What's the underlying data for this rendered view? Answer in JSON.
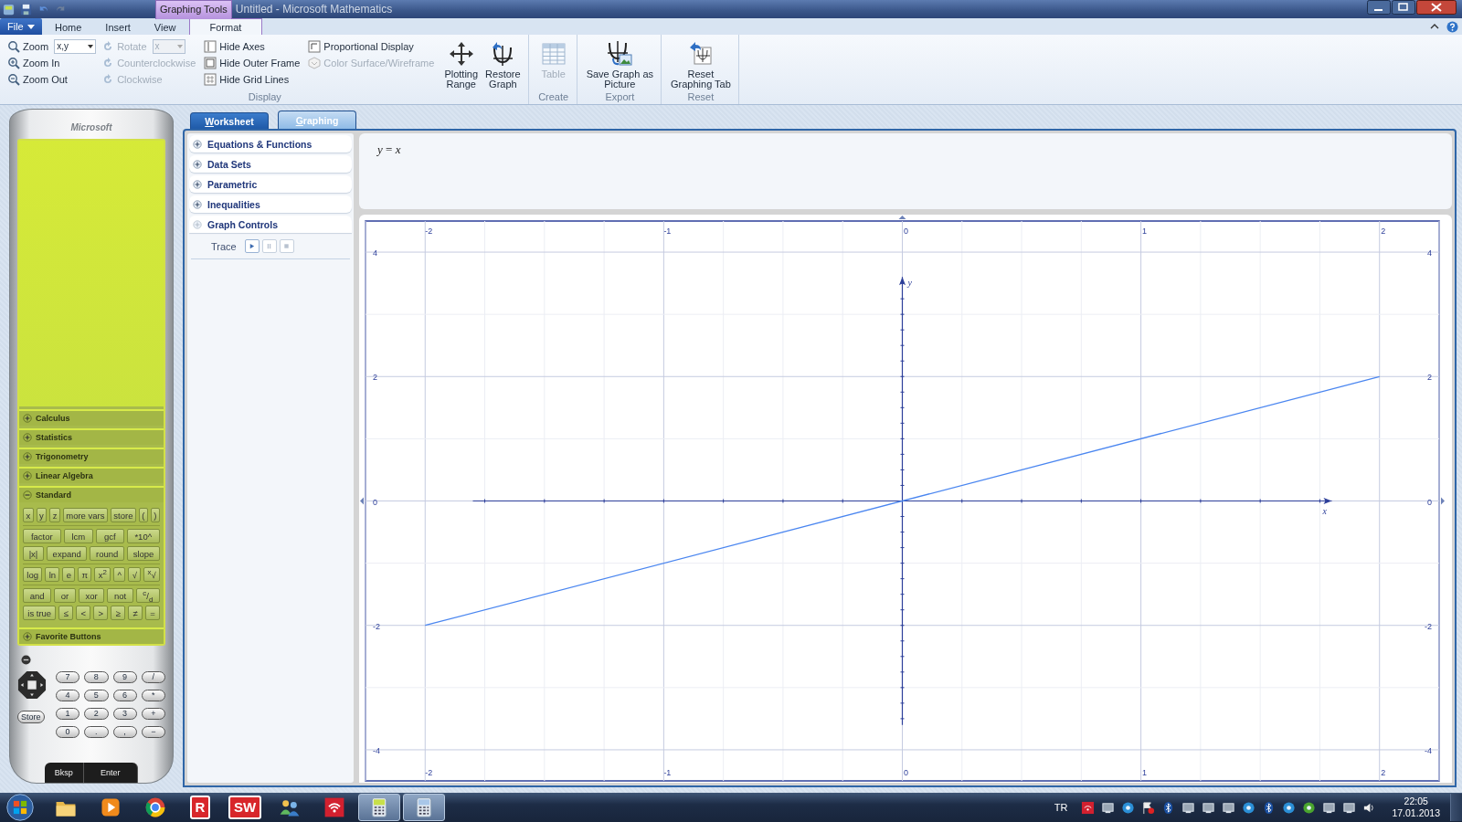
{
  "window": {
    "context_label": "Graphing Tools",
    "title": "Untitled - Microsoft Mathematics"
  },
  "ribbon": {
    "tabs": [
      {
        "label": "File",
        "kind": "menu",
        "selected": false
      },
      {
        "label": "Home",
        "kind": "tab",
        "selected": false
      },
      {
        "label": "Insert",
        "kind": "tab",
        "selected": false
      },
      {
        "label": "View",
        "kind": "tab",
        "selected": false
      },
      {
        "label": "Format",
        "kind": "tab",
        "selected": true
      }
    ],
    "groups": [
      {
        "label": "Display",
        "columns": [
          [
            {
              "kind": "combo",
              "label": "Zoom",
              "value": "x,y",
              "disabled": false
            },
            {
              "kind": "button",
              "label": "Zoom In",
              "disabled": false
            },
            {
              "kind": "button",
              "label": "Zoom Out",
              "disabled": false
            }
          ],
          [
            {
              "kind": "combo",
              "label": "Rotate",
              "value": "x",
              "disabled": true
            },
            {
              "kind": "button",
              "label": "Counterclockwise",
              "disabled": true
            },
            {
              "kind": "button",
              "label": "Clockwise",
              "disabled": true
            }
          ],
          [
            {
              "kind": "button",
              "label": "Hide Axes",
              "disabled": false
            },
            {
              "kind": "button",
              "label": "Hide Outer Frame",
              "disabled": false
            },
            {
              "kind": "button",
              "label": "Hide Grid Lines",
              "disabled": false
            }
          ],
          [
            {
              "kind": "button",
              "label": "Proportional Display",
              "disabled": false
            },
            {
              "kind": "button",
              "label": "Color Surface/Wireframe",
              "disabled": true
            }
          ]
        ],
        "buttons": [
          {
            "lines": [
              "Plotting",
              "Range"
            ],
            "disabled": false
          },
          {
            "lines": [
              "Restore",
              "Graph"
            ],
            "disabled": false
          }
        ]
      },
      {
        "label": "Create",
        "buttons": [
          {
            "lines": [
              "Table"
            ],
            "disabled": true
          }
        ]
      },
      {
        "label": "Export",
        "buttons": [
          {
            "lines": [
              "Save Graph as",
              "Picture"
            ],
            "disabled": false
          }
        ]
      },
      {
        "label": "Reset",
        "buttons": [
          {
            "lines": [
              "Reset",
              "Graphing Tab"
            ],
            "disabled": false
          }
        ]
      }
    ]
  },
  "calculator": {
    "brand": "Microsoft",
    "sections": [
      {
        "label": "Calculus",
        "expanded": false
      },
      {
        "label": "Statistics",
        "expanded": false
      },
      {
        "label": "Trigonometry",
        "expanded": false
      },
      {
        "label": "Linear Algebra",
        "expanded": false
      },
      {
        "label": "Standard",
        "expanded": true
      },
      {
        "label": "Favorite Buttons",
        "expanded": false
      }
    ],
    "standard_keys": [
      [
        [
          "x",
          "y",
          "z",
          "more vars",
          "store",
          "(",
          ")"
        ]
      ],
      [
        [
          "factor",
          "lcm",
          "gcf",
          "*10^"
        ],
        [
          "|x|",
          "expand",
          "round",
          "slope"
        ]
      ],
      [
        [
          "log",
          "ln",
          "e",
          "π",
          "x$^{2}$",
          "^",
          "√",
          "$^{x}$√"
        ]
      ],
      [
        [
          "and",
          "or",
          "xor",
          "not",
          "$^{c}$/$_{d}$"
        ],
        [
          "is true",
          "≤",
          "<",
          ">",
          "≥",
          "≠",
          "="
        ]
      ]
    ],
    "keypad": [
      [
        "7",
        "8",
        "9",
        "/"
      ],
      [
        "4",
        "5",
        "6",
        "*"
      ],
      [
        "1",
        "2",
        "3",
        "+"
      ],
      [
        "0",
        ".",
        ",",
        "−"
      ]
    ],
    "store": "Store",
    "bksp": "Bksp",
    "enter": "Enter"
  },
  "doc_tabs": [
    {
      "label": "Worksheet",
      "selected": false
    },
    {
      "label": "Graphing",
      "selected": true
    }
  ],
  "graph_panel": {
    "sections": [
      {
        "label": "Equations & Functions",
        "expanded": false
      },
      {
        "label": "Data Sets",
        "expanded": false
      },
      {
        "label": "Parametric",
        "expanded": false
      },
      {
        "label": "Inequalities",
        "expanded": false
      },
      {
        "label": "Graph Controls",
        "expanded": true
      }
    ],
    "trace": {
      "label": "Trace",
      "buttons": [
        {
          "kind": "play",
          "disabled": false
        },
        {
          "kind": "pause",
          "disabled": true
        },
        {
          "kind": "stop",
          "disabled": true
        }
      ]
    }
  },
  "equation": "*y* = *x*",
  "graph": {
    "chart_data": {
      "type": "line",
      "xlabel": "x",
      "ylabel": "y",
      "x": [
        -2,
        2
      ],
      "series": [
        {
          "color": "#4a86f0",
          "values": [
            -2,
            2
          ]
        }
      ],
      "xlim": [
        -2.25,
        2.25
      ],
      "ylim": [
        -4.5,
        4.5
      ],
      "xticks": [
        -2,
        -1,
        0,
        1,
        2
      ],
      "yticks": [
        -4,
        -2,
        0,
        2,
        4
      ],
      "grid": true
    },
    "bottom_tick_labels": [
      "-2",
      "-1",
      "0",
      "1",
      "2"
    ],
    "right_tick_labels": [
      "4",
      "2",
      "0",
      "-2",
      "-4"
    ]
  },
  "taskbar": {
    "apps": [
      {
        "kind": "folder",
        "running": false
      },
      {
        "kind": "player",
        "running": false
      },
      {
        "kind": "browser",
        "running": false
      },
      {
        "kind": "letter",
        "text": "R",
        "running": false
      },
      {
        "kind": "letter",
        "text": "SW",
        "running": false
      },
      {
        "kind": "people",
        "running": false
      },
      {
        "kind": "wireless",
        "running": false
      },
      {
        "kind": "math",
        "running": true
      },
      {
        "kind": "calculator",
        "running": true
      }
    ],
    "language": "TR",
    "time": "22:05",
    "date": "17.01.2013"
  }
}
